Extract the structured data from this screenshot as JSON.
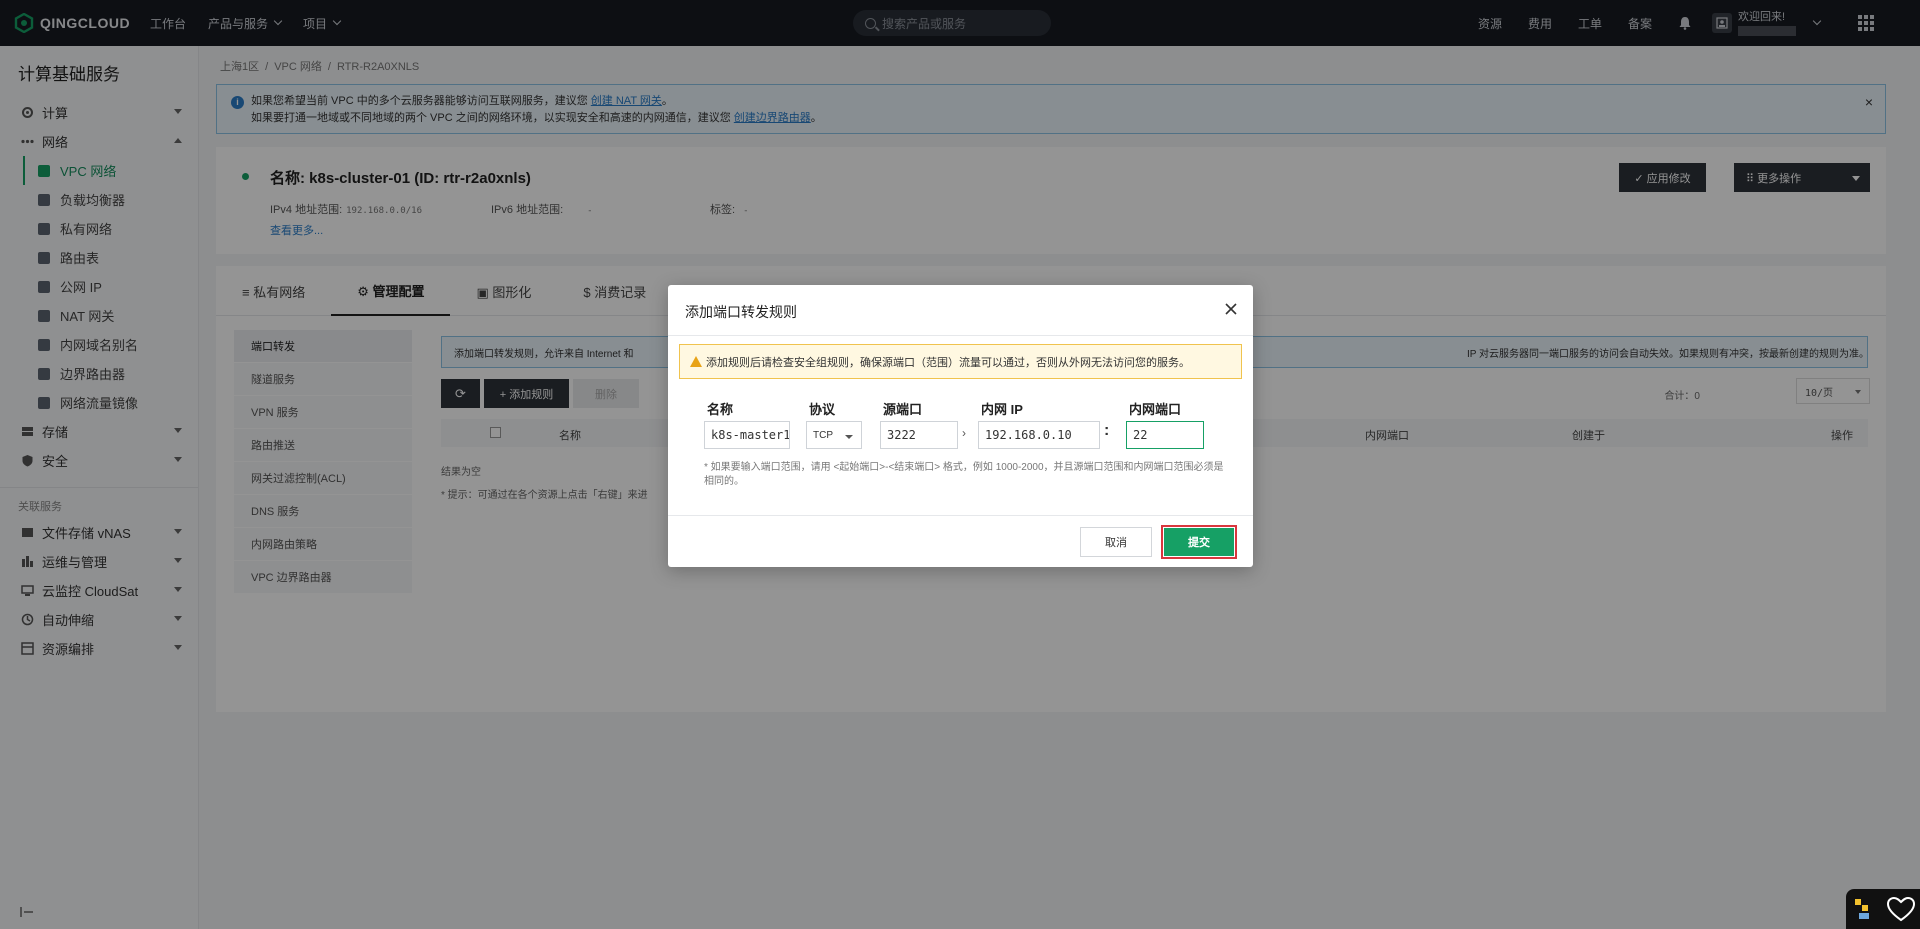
{
  "topbar": {
    "logo": "QINGCLOUD",
    "nav": [
      "工作台",
      "产品与服务",
      "项目"
    ],
    "search_placeholder": "搜索产品或服务",
    "links": [
      "资源",
      "费用",
      "工单",
      "备案"
    ],
    "welcome": "欢迎回来!"
  },
  "sidebar": {
    "title": "计算基础服务",
    "compute": "计算",
    "network": "网络",
    "network_items": [
      "VPC 网络",
      "负载均衡器",
      "私有网络",
      "路由表",
      "公网 IP",
      "NAT 网关",
      "内网域名别名",
      "边界路由器",
      "网络流量镜像"
    ],
    "storage": "存储",
    "security": "安全",
    "related_group": "关联服务",
    "related_items": [
      "文件存储 vNAS",
      "运维与管理",
      "云监控 CloudSat",
      "自动伸缩",
      "资源编排"
    ]
  },
  "breadcrumb": [
    "上海1区",
    "/",
    "VPC 网络",
    "/",
    "RTR-R2A0XNLS"
  ],
  "notice": {
    "line1_pre": "如果您希望当前 VPC 中的多个云服务器能够访问互联网服务，建议您",
    "line1_link": "创建 NAT 网关",
    "line1_post": "。",
    "line2_pre": "如果要打通一地域或不同地域的两个 VPC 之间的网络环境，以实现安全和高速的内网通信，建议您",
    "line2_link": "创建边界路由器",
    "line2_post": "。"
  },
  "resource": {
    "name": "名称: k8s-cluster-01 (ID: rtr-r2a0xnls)",
    "ipv4_label": "IPv4 地址范围:",
    "ipv4_value": "192.168.0.0/16",
    "ipv6_label": "IPv6 地址范围:",
    "ipv6_value": "-",
    "tag_label": "标签:",
    "tag_value": "-",
    "more": "查看更多...",
    "apply": "✓ 应用修改",
    "more_ops": "⠿ 更多操作"
  },
  "tabs": [
    "≡ 私有网络",
    "⚙ 管理配置",
    "▣ 图形化",
    "$ 消费记录"
  ],
  "subnav": [
    "端口转发",
    "隧道服务",
    "VPN 服务",
    "路由推送",
    "网关过滤控制(ACL)",
    "DNS 服务",
    "内网路由策略",
    "VPC 边界路由器"
  ],
  "content": {
    "notice": "添加端口转发规则，允许来自 Internet 和",
    "notice_tail": "IP 对云服务器同一端口服务的访问会自动失效。如果规则有冲突，按最新创建的规则为准。",
    "refresh": "⟳",
    "add": "+ 添加规则",
    "delete": "删除",
    "total": "合计：0",
    "per_page": "10/页",
    "columns": [
      "名称",
      "内网端口",
      "创建于",
      "操作"
    ],
    "empty": "结果为空",
    "hint": "* 提示：可通过在各个资源上点击「右键」来进"
  },
  "modal": {
    "title": "添加端口转发规则",
    "warning": "添加规则后请检查安全组规则，确保源端口（范围）流量可以通过，否则从外网无法访问您的服务。",
    "labels": {
      "name": "名称",
      "protocol": "协议",
      "src_port": "源端口",
      "inner_ip": "内网 IP",
      "inner_port": "内网端口"
    },
    "values": {
      "name": "k8s-master1",
      "protocol": "TCP",
      "src_port": "3222",
      "inner_ip": "192.168.0.10",
      "inner_port": "22"
    },
    "help": "* 如果要输入端口范围，请用 <起始端口>-<结束端口> 格式，例如 1000-2000，并且源端口范围和内网端口范围必须是相同的。",
    "cancel": "取消",
    "submit": "提交"
  },
  "colors": {
    "accent": "#16a065",
    "dark": "#171b22",
    "highlight": "#d9363e"
  }
}
